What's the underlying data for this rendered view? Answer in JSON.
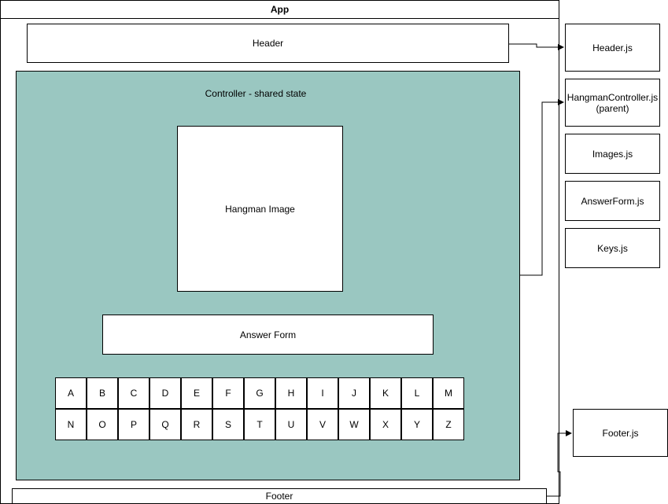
{
  "app": {
    "title": "App"
  },
  "header": {
    "label": "Header"
  },
  "controller": {
    "label": "Controller - shared state"
  },
  "hangman_image": {
    "label": "Hangman Image"
  },
  "answer_form": {
    "label": "Answer Form"
  },
  "keys": {
    "row1": [
      "A",
      "B",
      "C",
      "D",
      "E",
      "F",
      "G",
      "H",
      "I",
      "J",
      "K",
      "L",
      "M"
    ],
    "row2": [
      "N",
      "O",
      "P",
      "Q",
      "R",
      "S",
      "T",
      "U",
      "V",
      "W",
      "X",
      "Y",
      "Z"
    ]
  },
  "footer": {
    "label": "Footer"
  },
  "files": {
    "header": "Header.js",
    "controller_line1": "HangmanController.js",
    "controller_line2": "(parent)",
    "images": "Images.js",
    "answer_form": "AnswerForm.js",
    "keys": "Keys.js",
    "footer": "Footer.js"
  },
  "colors": {
    "controller_fill": "#9ac7c1",
    "stroke": "#000000"
  }
}
